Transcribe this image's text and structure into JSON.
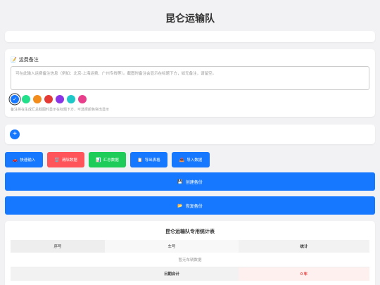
{
  "page_title": "昆仑运输队",
  "note": {
    "icon": "📝",
    "label": "运费备注",
    "placeholder": "可在此输入运费备注信息（例如：北京-上海运费、广州专线等）。截图时备注会显示在标题下方，如无备注，请留空。",
    "hint": "备注将在生成汇总截图时显示在标题下方，可选择颜色突出显示"
  },
  "colors": {
    "swatches": [
      "#1677ff",
      "#22e08a",
      "#f28c1c",
      "#e53935",
      "#8a35e5",
      "#1ec8c8",
      "#e83e8c"
    ],
    "selected_index": 0,
    "accent": "#1677ff"
  },
  "add_button": {
    "label": "+"
  },
  "toolbar": {
    "buttons": [
      {
        "icon": "🚗",
        "label": "快速输入",
        "color": "#1677ff"
      },
      {
        "icon": "🗑️",
        "label": "清除数据",
        "color": "#ff5459"
      },
      {
        "icon": "📊",
        "label": "汇总数据",
        "color": "#1ecc5a"
      },
      {
        "icon": "📋",
        "label": "导出表格",
        "color": "#1677ff"
      },
      {
        "icon": "📥",
        "label": "导入数据",
        "color": "#1677ff"
      }
    ]
  },
  "backup": {
    "create_icon": "💾",
    "create_label": "创建备份",
    "restore_icon": "📂",
    "restore_label": "恢复备份"
  },
  "table": {
    "title": "昆仑运输队专用统计表",
    "headers": [
      "序号",
      "车号",
      "统计"
    ],
    "empty_text": "暂无车辆数据",
    "total_label": "日期合计",
    "total_value": "0 车"
  }
}
